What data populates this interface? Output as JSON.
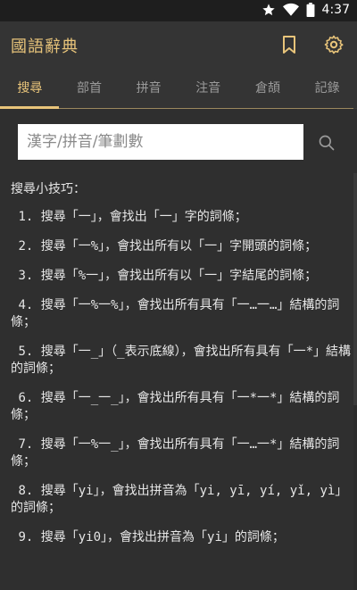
{
  "status_bar": {
    "time": "4:37"
  },
  "app": {
    "title": "國語辭典"
  },
  "tabs": [
    {
      "label": "搜尋",
      "active": true
    },
    {
      "label": "部首",
      "active": false
    },
    {
      "label": "拼音",
      "active": false
    },
    {
      "label": "注音",
      "active": false
    },
    {
      "label": "倉頡",
      "active": false
    },
    {
      "label": "記錄",
      "active": false
    }
  ],
  "search": {
    "placeholder": "漢字/拼音/筆劃數",
    "value": ""
  },
  "tips": {
    "heading": "搜尋小技巧：",
    "items": [
      " 1. 搜尋「一」，會找出「一」字的詞條；",
      " 2. 搜尋「一%」，會找出所有以「一」字開頭的詞條；",
      " 3. 搜尋「%一」，會找出所有以「一」字結尾的詞條；",
      " 4. 搜尋「一%一%」，會找出所有具有「一…一…」結構的詞條；",
      " 5. 搜尋「一_」（_表示底線），會找出所有具有「一*」結構的詞條；",
      " 6. 搜尋「一_一_」，會找出所有具有「一*一*」結構的詞條；",
      " 7. 搜尋「一%一_」，會找出所有具有「一…一*」結構的詞條；",
      " 8. 搜尋「yi」，會找出拼音為「yi, yī, yí, yǐ, yì」的詞條；",
      " 9. 搜尋「yi0」，會找出拼音為「yi」的詞條；"
    ]
  },
  "colors": {
    "accent": "#e8c47a",
    "background": "#2f2f2f",
    "appbar": "#343434"
  }
}
